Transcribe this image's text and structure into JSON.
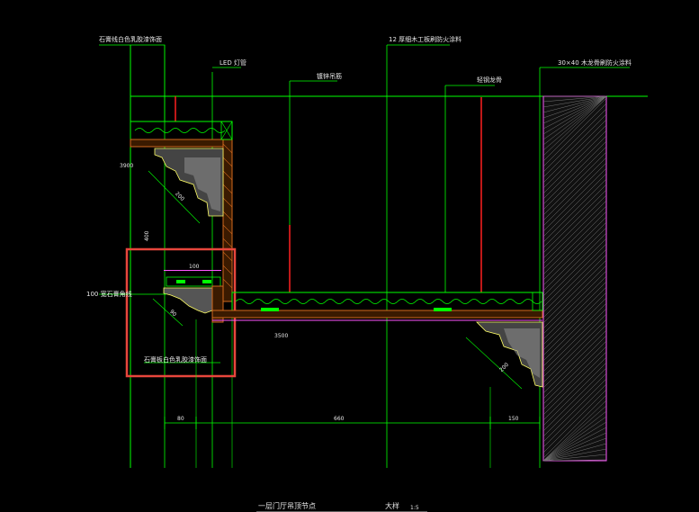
{
  "colors": {
    "background": "#000000",
    "green": "#00ff00",
    "red": "#ff2020",
    "orange": "#d2691e",
    "yellow": "#ffff00",
    "magenta": "#ff55ff",
    "white": "#ffffff",
    "highlight": "#e8463c"
  },
  "annotations": {
    "plaster_cornice_top": "石膏线白色乳胶漆饰面",
    "led_tube": "LED 灯管",
    "fireproof_board_top": "12 厚细木工板刷防火涂料",
    "steel_hanger": "镀锌吊筋",
    "light_steel_keel": "轻钢龙骨",
    "wood_fireproof_right": "30×40 木龙骨刷防火涂料",
    "stone_glue_line": "100 宽石膏角线",
    "plaster_cornice_bottom": "石膏板白色乳胶漆饰面"
  },
  "dimensions": {
    "dim_3900": "3900",
    "dim_400": "400",
    "dim_200_upper": "200",
    "dim_100": "100",
    "dim_90": "90",
    "dim_3500": "3500",
    "dim_200_right": "200",
    "dim_80": "80",
    "dim_660": "660",
    "dim_150": "150"
  },
  "title": {
    "text": "一层门厅吊顶节点",
    "scale": "大样",
    "suffix": "1:5"
  }
}
